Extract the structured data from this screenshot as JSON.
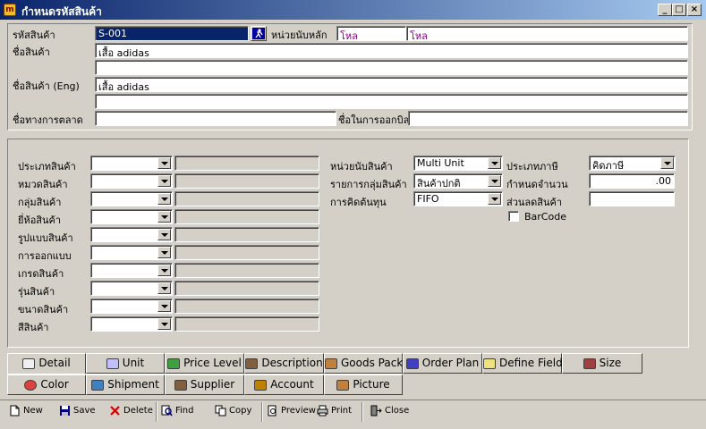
{
  "window": {
    "title": "กำหนดรหัสสินค้า",
    "minimize": "_",
    "maximize": "□",
    "close": "×"
  },
  "header": {
    "code_label": "รหัสสินค้า",
    "code_value": "S-001",
    "main_unit_label": "หน่วยนับหลัก",
    "main_unit_value_1": "โหล",
    "main_unit_value_2": "โหล",
    "name_label": "ชื่อสินค้า",
    "name_value": "เสื้อ adidas",
    "name_line2_value": "",
    "name_eng_label": "ชื่อสินค้า (Eng)",
    "name_eng_value": "เสื้อ adidas",
    "name_eng_line2_value": "",
    "marketing_name_label": "ชื่อทางการตลาด",
    "marketing_name_value": "",
    "billing_name_label": "ชื่อในการออกบิล",
    "billing_name_value": ""
  },
  "detail": {
    "left_labels": [
      "ประเภทสินค้า",
      "หมวดสินค้า",
      "กลุ่มสินค้า",
      "ยี่ห้อสินค้า",
      "รูปแบบสินค้า",
      "การออกแบบ",
      "เกรดสินค้า",
      "รุ่นสินค้า",
      "ขนาดสินค้า",
      "สีสินค้า"
    ],
    "unit_label": "หน่วยนับสินค้า",
    "unit_value": "Multi Unit",
    "group_list_label": "รายการกลุ่มสินค้า",
    "group_list_value": "สินค้าปกติ",
    "costing_label": "การคิดต้นทุน",
    "costing_value": "FIFO",
    "tax_type_label": "ประเภทภาษี",
    "tax_type_value": "คิดภาษี",
    "quantity_label": "กำหนดจำนวน",
    "quantity_value": ".00",
    "discount_label": "ส่วนลดสินค้า",
    "discount_value": "",
    "barcode_label": "BarCode"
  },
  "tabs": {
    "row1": [
      "Detail",
      "Unit",
      "Price Level",
      "Description",
      "Goods Pack",
      "Order Plan",
      "Define Field",
      "Size"
    ],
    "row2": [
      "Color",
      "Shipment",
      "Supplier",
      "Account",
      "Picture"
    ]
  },
  "toolbar": {
    "new": "New",
    "save": "Save",
    "delete": "Delete",
    "find": "Find",
    "copy": "Copy",
    "preview": "Preview",
    "print": "Print",
    "close": "Close"
  }
}
